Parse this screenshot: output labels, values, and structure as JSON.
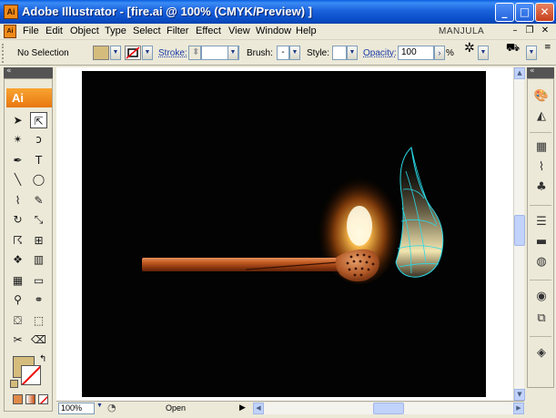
{
  "window": {
    "title": "Adobe Illustrator - [fire.ai @ 100% (CMYK/Preview) ]",
    "app_badge": "Ai",
    "minimize": "_",
    "maximize": "□",
    "close": "✕"
  },
  "menubar": {
    "items": [
      "File",
      "Edit",
      "Object",
      "Type",
      "Select",
      "Filter",
      "Effect",
      "View",
      "Window",
      "Help"
    ],
    "user": "MANJULA",
    "doc_badge": "Ai",
    "mdi_min": "–",
    "mdi_restore": "❐",
    "mdi_close": "✕"
  },
  "controlbar": {
    "selection": "No Selection",
    "stroke_label": "Stroke:",
    "brush_label": "Brush:",
    "brush_value": "-",
    "style_label": "Style:",
    "opacity_label": "Opacity:",
    "opacity_value": "100",
    "opacity_unit": "%",
    "fill_color": "#d4bc7c"
  },
  "toolbox": {
    "tab_label": "Ai",
    "fill_color": "#d4bc7c",
    "tools": [
      {
        "name": "selection-tool-icon",
        "glyph": "➤"
      },
      {
        "name": "direct-selection-tool-icon",
        "glyph": "⇱"
      },
      {
        "name": "magic-wand-tool-icon",
        "glyph": "✴"
      },
      {
        "name": "lasso-tool-icon",
        "glyph": "ↄ"
      },
      {
        "name": "pen-tool-icon",
        "glyph": "✒"
      },
      {
        "name": "type-tool-icon",
        "glyph": "T"
      },
      {
        "name": "line-tool-icon",
        "glyph": "╲"
      },
      {
        "name": "ellipse-tool-icon",
        "glyph": "◯"
      },
      {
        "name": "paintbrush-tool-icon",
        "glyph": "⌇"
      },
      {
        "name": "pencil-tool-icon",
        "glyph": "✎"
      },
      {
        "name": "rotate-tool-icon",
        "glyph": "↻"
      },
      {
        "name": "scale-tool-icon",
        "glyph": "⤡"
      },
      {
        "name": "warp-tool-icon",
        "glyph": "☈"
      },
      {
        "name": "free-transform-tool-icon",
        "glyph": "⊞"
      },
      {
        "name": "symbol-sprayer-tool-icon",
        "glyph": "❖"
      },
      {
        "name": "column-graph-tool-icon",
        "glyph": "▥"
      },
      {
        "name": "mesh-tool-icon",
        "glyph": "▦"
      },
      {
        "name": "gradient-tool-icon",
        "glyph": "▭"
      },
      {
        "name": "eyedropper-tool-icon",
        "glyph": "⚲"
      },
      {
        "name": "blend-tool-icon",
        "glyph": "⚭"
      },
      {
        "name": "live-paint-bucket-tool-icon",
        "glyph": "⛋"
      },
      {
        "name": "live-paint-selection-tool-icon",
        "glyph": "⬚"
      },
      {
        "name": "slice-tool-icon",
        "glyph": "✂"
      },
      {
        "name": "eraser-tool-icon",
        "glyph": "⌫"
      },
      {
        "name": "hand-tool-icon",
        "glyph": "✋"
      },
      {
        "name": "zoom-tool-icon",
        "glyph": "🔍"
      }
    ]
  },
  "statusbar": {
    "zoom": "100%",
    "status": "Open"
  },
  "dock": {
    "icons": [
      "color-panel-icon",
      "gradient-panel-icon",
      "swatches-panel-icon",
      "brushes-panel-icon",
      "symbols-panel-icon",
      "stroke-panel-icon",
      "transparency-panel-icon",
      "appearance-panel-icon",
      "graphic-styles-panel-icon",
      "layers-panel-icon"
    ]
  }
}
